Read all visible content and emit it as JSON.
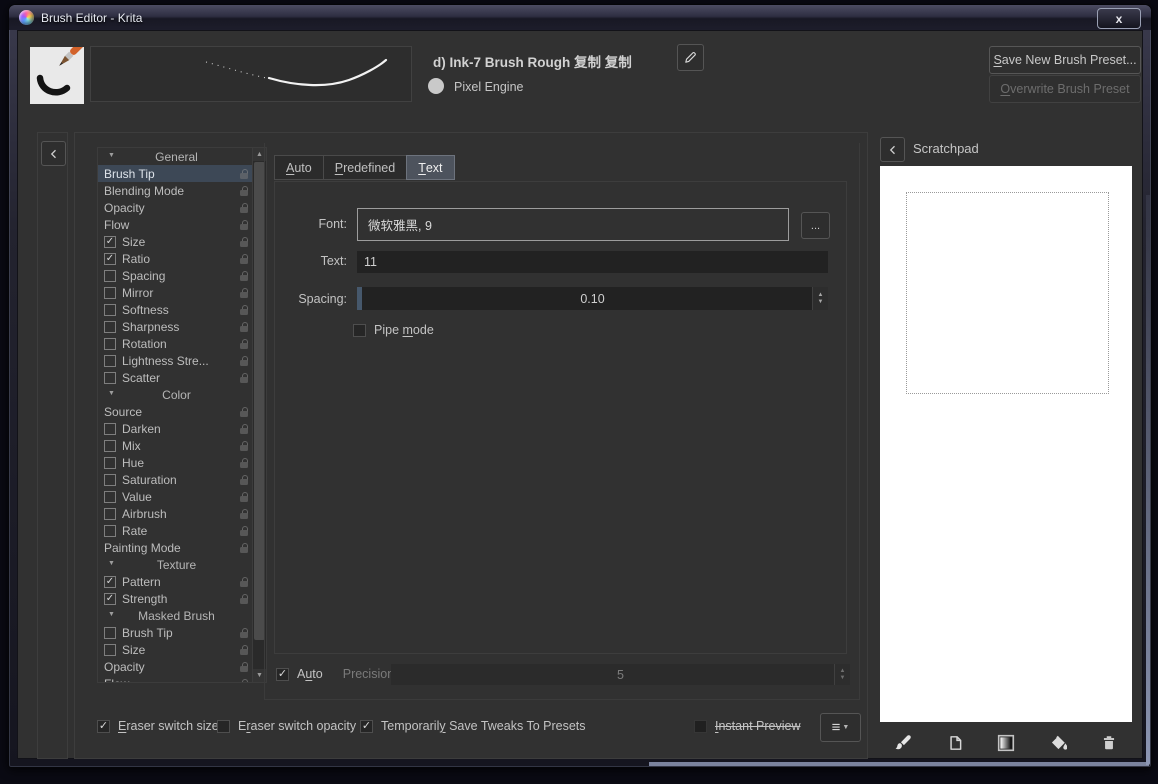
{
  "window": {
    "title": "Brush Editor - Krita",
    "close_label": "x"
  },
  "header": {
    "brush_name": "d) Ink-7 Brush Rough 复制 复制",
    "engine": "Pixel Engine",
    "save_button": {
      "text": "Save New Brush Preset...",
      "u": 0
    },
    "overwrite_button": {
      "text": "Overwrite Brush Preset",
      "u": 0
    }
  },
  "options_panel": {
    "items": [
      {
        "t": "h",
        "label": "General"
      },
      {
        "t": "p",
        "label": "Brush Tip",
        "selected": true
      },
      {
        "t": "p",
        "label": "Blending Mode"
      },
      {
        "t": "p",
        "label": "Opacity"
      },
      {
        "t": "p",
        "label": "Flow"
      },
      {
        "t": "c",
        "label": "Size",
        "checked": true
      },
      {
        "t": "c",
        "label": "Ratio",
        "checked": true
      },
      {
        "t": "c",
        "label": "Spacing",
        "checked": false
      },
      {
        "t": "c",
        "label": "Mirror",
        "checked": false
      },
      {
        "t": "c",
        "label": "Softness",
        "checked": false
      },
      {
        "t": "c",
        "label": "Sharpness",
        "checked": false
      },
      {
        "t": "c",
        "label": "Rotation",
        "checked": false
      },
      {
        "t": "c",
        "label": "Lightness Stre...",
        "checked": false
      },
      {
        "t": "c",
        "label": "Scatter",
        "checked": false
      },
      {
        "t": "h",
        "label": "Color"
      },
      {
        "t": "p",
        "label": "Source"
      },
      {
        "t": "c",
        "label": "Darken",
        "checked": false
      },
      {
        "t": "c",
        "label": "Mix",
        "checked": false
      },
      {
        "t": "c",
        "label": "Hue",
        "checked": false
      },
      {
        "t": "c",
        "label": "Saturation",
        "checked": false
      },
      {
        "t": "c",
        "label": "Value",
        "checked": false
      },
      {
        "t": "c",
        "label": "Airbrush",
        "checked": false
      },
      {
        "t": "c",
        "label": "Rate",
        "checked": false
      },
      {
        "t": "p",
        "label": "Painting Mode"
      },
      {
        "t": "h",
        "label": "Texture"
      },
      {
        "t": "c",
        "label": "Pattern",
        "checked": true
      },
      {
        "t": "c",
        "label": "Strength",
        "checked": true
      },
      {
        "t": "h",
        "label": "Masked Brush"
      },
      {
        "t": "c",
        "label": "Brush Tip",
        "checked": false
      },
      {
        "t": "c",
        "label": "Size",
        "checked": false
      },
      {
        "t": "p",
        "label": "Opacity"
      },
      {
        "t": "p",
        "label": "Flow"
      }
    ]
  },
  "tabs": [
    {
      "text": "Auto",
      "u": 0,
      "selected": false
    },
    {
      "text": "Predefined",
      "u": 0,
      "selected": false
    },
    {
      "text": "Text",
      "u": 0,
      "selected": true
    }
  ],
  "text_tab": {
    "font_label": "Font:",
    "font_value": "微软雅黑, 9",
    "browse_label": "...",
    "text_label": "Text:",
    "text_value": "11",
    "spacing_label": "Spacing:",
    "spacing_value": "0.10",
    "pipe_mode": {
      "text": "Pipe mode",
      "u": 5,
      "checked": false
    }
  },
  "precision_row": {
    "auto": {
      "text": "Auto",
      "u": 1,
      "checked": true
    },
    "precision_label": "Precision:",
    "precision_value": "5"
  },
  "footer": {
    "checkboxes": [
      {
        "text": "Eraser switch size",
        "u": 0,
        "checked": true
      },
      {
        "text": "Eraser switch opacity",
        "u": 1,
        "checked": false
      },
      {
        "text": "Temporarily Save Tweaks To Presets",
        "u": 10,
        "checked": true
      },
      {
        "text": "Instant Preview",
        "u": 0,
        "checked": false,
        "strike": true
      }
    ]
  },
  "scratchpad": {
    "title": "Scratchpad",
    "tools": [
      "paintbrush-icon",
      "document-icon",
      "gradient-icon",
      "fill-icon",
      "trash-icon"
    ]
  },
  "colors": {
    "selection": "#3d4856",
    "slider_fill": "#46586c",
    "canvas": "#ffffff",
    "frame_glow": "#8d97b4"
  }
}
